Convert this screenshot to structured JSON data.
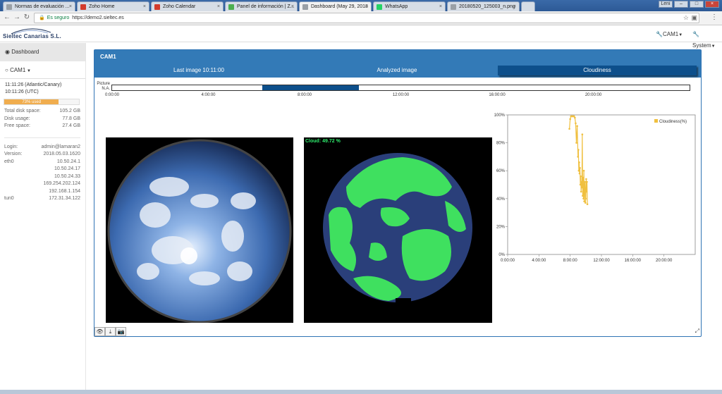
{
  "browser": {
    "tabs": [
      {
        "title": "Normas de evaluación ...",
        "icon": "doc-icon",
        "color": "#9aa0a6"
      },
      {
        "title": "Zoho Home",
        "icon": "zoho-icon",
        "color": "#d33b2c"
      },
      {
        "title": "Zoho Calendar",
        "icon": "calendar-icon",
        "color": "#d33b2c"
      },
      {
        "title": "Panel de información | Z...",
        "icon": "sheet-icon",
        "color": "#4caf50"
      },
      {
        "title": "Dashboard (May 29, 2018",
        "icon": "page-icon",
        "color": "#9aa0a6"
      },
      {
        "title": "WhatsApp",
        "icon": "whatsapp-icon",
        "color": "#25d366"
      },
      {
        "title": "20180520_125003_n.png",
        "icon": "page-icon",
        "color": "#9aa0a6"
      }
    ],
    "security_label": "Es seguro",
    "url": "https://demo2.sieltec.es",
    "user_badge": "Leni"
  },
  "topnav": {
    "logo_text": "Sieltec Canarias S.L.",
    "cam_menu": "CAM1",
    "system_menu": "System"
  },
  "sidebar": {
    "dashboard_label": "Dashboard",
    "cam_label": "CAM1",
    "time_local": "11:11:26 (Atlantic/Canary)",
    "time_utc": "10:11:26 (UTC)",
    "disk_used_label": "73% used",
    "disk_used_pct": 73,
    "disk": [
      {
        "k": "Total disk space:",
        "v": "105.2 GB"
      },
      {
        "k": "Disk usage:",
        "v": "77.8 GB"
      },
      {
        "k": "Free space:",
        "v": "27.4 GB"
      }
    ],
    "info": [
      {
        "k": "Login:",
        "v": "admin@lamaran2"
      },
      {
        "k": "Version:",
        "v": "2018.05.03.1620"
      },
      {
        "k": "eth0",
        "v": "10.50.24.1"
      },
      {
        "k": "",
        "v": "10.50.24.17"
      },
      {
        "k": "",
        "v": "10.50.24.33"
      },
      {
        "k": "",
        "v": "169.254.202.124"
      },
      {
        "k": "",
        "v": "192.168.1.154"
      },
      {
        "k": "tun0",
        "v": "172.31.34.122"
      }
    ]
  },
  "panel": {
    "title": "CAM1",
    "tabs": [
      "Last image 10:11:00",
      "Analyzed image",
      "Cloudiness"
    ],
    "selected_tab": 2,
    "timeline_label_1": "Picture",
    "timeline_label_2": "N.A.",
    "timeline_ticks": [
      "0:00:00",
      "4:00:00",
      "8:00:00",
      "12:00:00",
      "16:00:00",
      "20:00:00"
    ],
    "timeline_selection_hours": [
      6.25,
      10.25
    ],
    "cloud_label": "Cloud: 49.72 %",
    "accent": "#337ab7",
    "selected_color": "#0d4f8b",
    "cloud_color": "#3fe05f"
  },
  "chart_data": {
    "type": "line",
    "title": "",
    "xlabel": "",
    "ylabel": "",
    "legend": [
      "Cloudiness(%)"
    ],
    "legend_position": "top-right",
    "x_ticks": [
      "0:00:00",
      "4:00:00",
      "8:00:00",
      "12:00:00",
      "16:00:00",
      "20:00:00"
    ],
    "y_ticks": [
      "0%",
      "20%",
      "40%",
      "60%",
      "80%",
      "100%"
    ],
    "xlim": [
      0,
      24
    ],
    "ylim": [
      0,
      100
    ],
    "color": "#f0c040",
    "series": [
      {
        "name": "Cloudiness(%)",
        "x": [
          7.9,
          8.0,
          8.1,
          8.2,
          8.3,
          8.4,
          8.5,
          8.6,
          8.7,
          8.8,
          8.9,
          9.0,
          9.05,
          9.1,
          9.15,
          9.2,
          9.25,
          9.3,
          9.35,
          9.4,
          9.45,
          9.5,
          9.55,
          9.6,
          9.65,
          9.7,
          9.75,
          9.8,
          9.85,
          9.9,
          9.95,
          10.0,
          10.05,
          10.1,
          10.15,
          10.2
        ],
        "y": [
          90,
          97,
          99,
          99,
          99,
          99,
          99,
          98,
          94,
          80,
          92,
          70,
          75,
          60,
          66,
          58,
          62,
          50,
          56,
          45,
          52,
          48,
          86,
          42,
          55,
          40,
          60,
          38,
          48,
          52,
          37,
          40,
          54,
          45,
          52,
          36
        ]
      }
    ]
  }
}
